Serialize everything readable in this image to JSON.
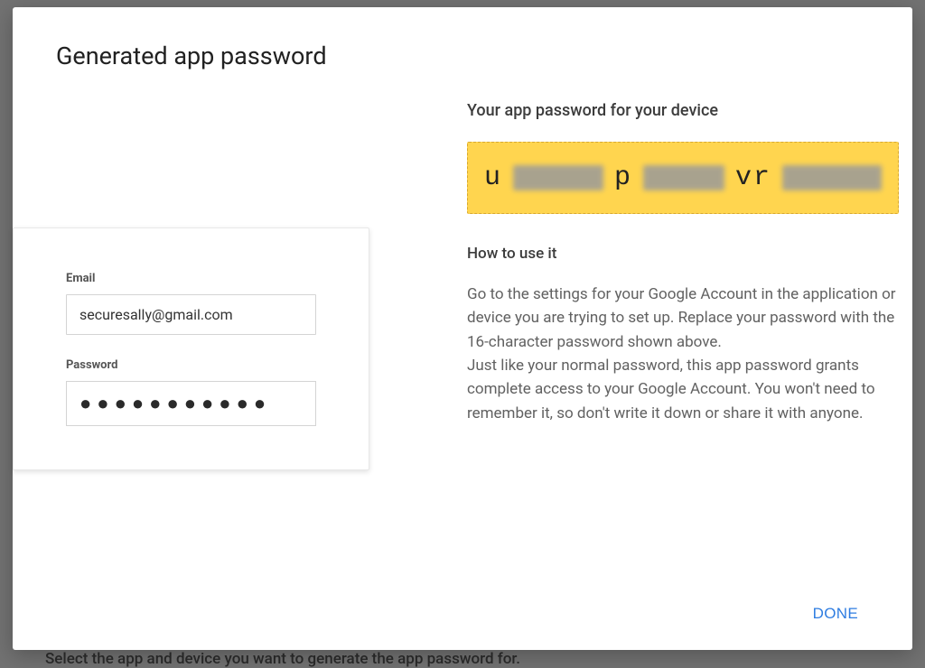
{
  "modal": {
    "title": "Generated app password"
  },
  "login_preview": {
    "email_label": "Email",
    "email_value": "securesally@gmail.com",
    "password_label": "Password",
    "password_dots": "●●●●●●●●●●●"
  },
  "right": {
    "heading": "Your app password for your device",
    "password_fragments": {
      "a": "u",
      "b": "p",
      "c": "vr"
    },
    "howto_heading": "How to use it",
    "howto_body": "Go to the settings for your Google Account in the application or device you are trying to set up. Replace your password with the 16-character password shown above.\nJust like your normal password, this app password grants complete access to your Google Account. You won't need to remember it, so don't write it down or share it with anyone."
  },
  "buttons": {
    "done": "DONE"
  },
  "background": {
    "hint": "Select the app and device you want to generate the app password for."
  }
}
